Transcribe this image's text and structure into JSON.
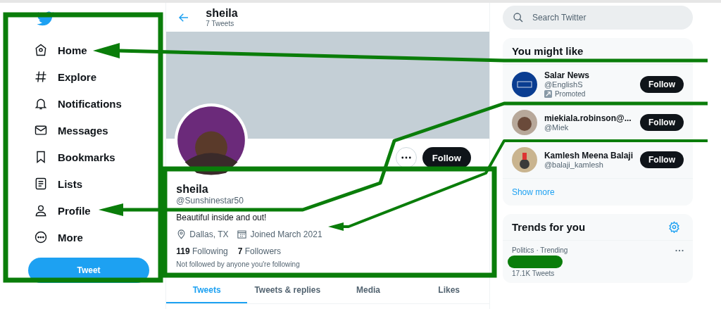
{
  "nav": {
    "items": [
      {
        "label": "Home",
        "kind": "home"
      },
      {
        "label": "Explore",
        "kind": "explore"
      },
      {
        "label": "Notifications",
        "kind": "notifications"
      },
      {
        "label": "Messages",
        "kind": "messages"
      },
      {
        "label": "Bookmarks",
        "kind": "bookmarks"
      },
      {
        "label": "Lists",
        "kind": "lists"
      },
      {
        "label": "Profile",
        "kind": "profile"
      },
      {
        "label": "More",
        "kind": "more"
      }
    ],
    "tweet_button": "Tweet"
  },
  "header": {
    "title": "sheila",
    "subtitle": "7 Tweets"
  },
  "profile": {
    "follow_button": "Follow",
    "name": "sheila",
    "handle": "@Sunshinestar50",
    "bio": "Beautiful inside and out!",
    "location": "Dallas, TX",
    "joined": "Joined March 2021",
    "following_count": "119",
    "following_label": "Following",
    "followers_count": "7",
    "followers_label": "Followers",
    "note": "Not followed by anyone you're following"
  },
  "tabs": [
    {
      "label": "Tweets",
      "selected": true
    },
    {
      "label": "Tweets & replies",
      "selected": false
    },
    {
      "label": "Media",
      "selected": false
    },
    {
      "label": "Likes",
      "selected": false
    }
  ],
  "search": {
    "placeholder": "Search Twitter"
  },
  "suggestions": {
    "title": "You might like",
    "items": [
      {
        "name": "Salar News",
        "handle": "@EnglishS",
        "promoted": "Promoted",
        "button": "Follow"
      },
      {
        "name": "miekiala.robinson@...",
        "handle": "@Miek",
        "button": "Follow"
      },
      {
        "name": "Kamlesh Meena Balaji",
        "handle": "@balaji_kamlesh",
        "button": "Follow"
      }
    ],
    "show_more": "Show more"
  },
  "trends": {
    "title": "Trends for you",
    "items": [
      {
        "context": "Politics · Trending",
        "count": "17.1K Tweets"
      }
    ]
  }
}
